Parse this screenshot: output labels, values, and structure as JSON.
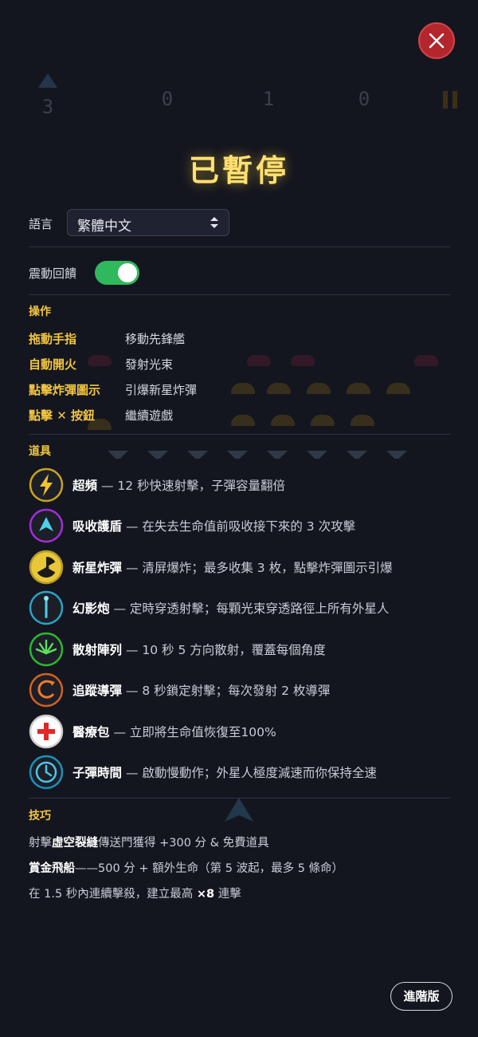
{
  "hud": {
    "lives": "3",
    "score": "0",
    "wave": "1",
    "bombs": "0"
  },
  "title": "已暫停",
  "settings": {
    "language_label": "語言",
    "language_value": "繁體中文",
    "haptics_label": "震動回饋",
    "haptics_on": true
  },
  "controls": {
    "heading": "操作",
    "items": [
      {
        "key": "拖動手指",
        "desc": "移動先鋒艦"
      },
      {
        "key": "自動開火",
        "desc": "發射光束"
      },
      {
        "key": "點擊炸彈圖示",
        "desc": "引爆新星炸彈"
      },
      {
        "key": "點擊 ✕ 按鈕",
        "desc": "繼續遊戲"
      }
    ]
  },
  "powerups": {
    "heading": "道具",
    "items": [
      {
        "icon": "lightning-icon",
        "name": "超頻",
        "desc": " — 12 秒快速射擊，子彈容量翻倍"
      },
      {
        "icon": "shield-ship-icon",
        "name": "吸收護盾",
        "desc": " — 在失去生命值前吸收接下來的 3 次攻擊"
      },
      {
        "icon": "radiation-icon",
        "name": "新星炸彈",
        "desc": " — 清屏爆炸；最多收集 3 枚，點擊炸彈圖示引爆"
      },
      {
        "icon": "phantom-beam-icon",
        "name": "幻影炮",
        "desc": " — 定時穿透射擊；每顆光束穿透路徑上所有外星人"
      },
      {
        "icon": "spread-icon",
        "name": "散射陣列",
        "desc": " — 10 秒 5 方向散射，覆蓋每個角度"
      },
      {
        "icon": "homing-missile-icon",
        "name": "追蹤導彈",
        "desc": " — 8 秒鎖定射擊；每次發射 2 枚導彈"
      },
      {
        "icon": "medkit-icon",
        "name": "醫療包",
        "desc": " — 立即將生命值恢復至100%"
      },
      {
        "icon": "clock-icon",
        "name": "子彈時間",
        "desc": " — 啟動慢動作；外星人極度減速而你保持全速"
      }
    ]
  },
  "tips": {
    "heading": "技巧",
    "line1_pre": "射擊",
    "line1_bold": "虛空裂縫",
    "line1_post": "傳送門獲得 +300 分 & 免費道具",
    "line2_bold": "賞金飛船",
    "line2_post": "——500 分 + 額外生命（第 5 波起，最多 5 條命）",
    "line3_pre": "在 1.5 秒內連續擊殺，建立最高 ",
    "line3_bold": "×8",
    "line3_post": " 連擊"
  },
  "advanced_button": "進階版",
  "colors": {
    "accent": "#f3c640",
    "title": "#ffe070",
    "toggle_on": "#2fb85c",
    "close_bg": "#b3262c"
  }
}
